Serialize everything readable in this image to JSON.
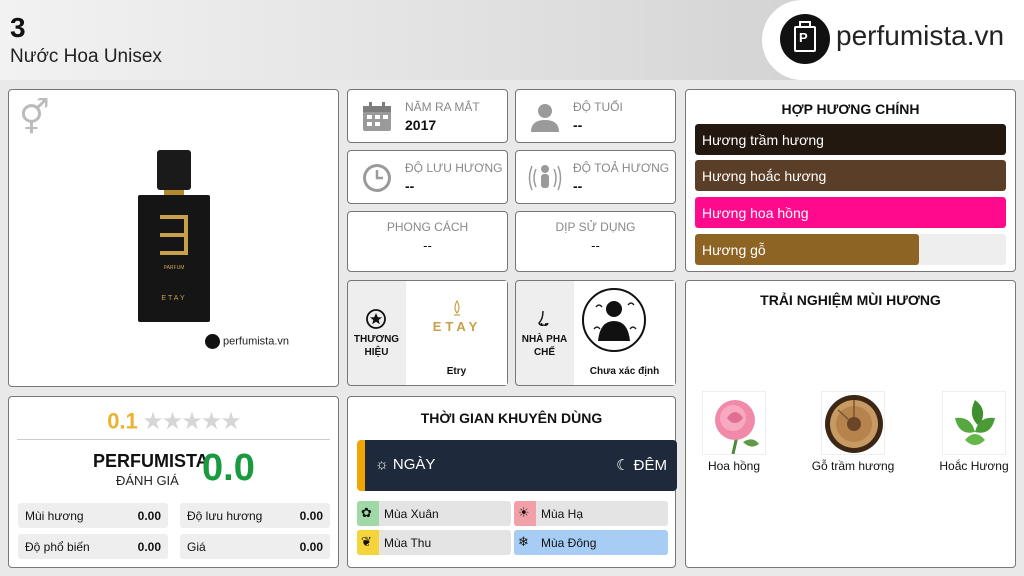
{
  "header": {
    "rank": "3",
    "subtitle": "Nước Hoa Unisex",
    "brand_site": "perfumista.vn"
  },
  "product": {
    "gender_icon": "male-female-icon",
    "bottle_brand": "ETAY",
    "bottle_label": "PARFUM",
    "watermark": "perfumista.vn"
  },
  "rating": {
    "user_score": "0.1",
    "stars": "★★★★★",
    "site_label": "PERFUMISTA",
    "site_sub": "ĐÁNH GIÁ",
    "site_score": "0.0",
    "metrics": [
      {
        "label": "Mùi hương",
        "value": "0.00"
      },
      {
        "label": "Độ lưu hương",
        "value": "0.00"
      },
      {
        "label": "Độ phổ biến",
        "value": "0.00"
      },
      {
        "label": "Giá",
        "value": "0.00"
      }
    ]
  },
  "info": {
    "release": {
      "label": "NĂM RA MẮT",
      "value": "2017"
    },
    "age": {
      "label": "ĐỘ TUỔI",
      "value": "--"
    },
    "longevity": {
      "label": "ĐỘ LƯU HƯƠNG",
      "value": "--"
    },
    "sillage": {
      "label": "ĐỘ TOẢ HƯƠNG",
      "value": "--"
    },
    "style": {
      "label": "PHONG CÁCH",
      "value": "--"
    },
    "occasion": {
      "label": "DỊP SỬ DỤNG",
      "value": "--"
    },
    "brand": {
      "label": "THƯƠNG HIỆU",
      "logo_text": "ETAY",
      "name": "Etry"
    },
    "perfumer": {
      "label": "NHÀ PHA CHẾ",
      "name": "Chưa xác định"
    }
  },
  "time": {
    "title": "THỜI GIAN KHUYÊN DÙNG",
    "day": "NGÀY",
    "night": "ĐÊM",
    "seasons": [
      {
        "label": "Mùa Xuân",
        "color": "#9ed9a6"
      },
      {
        "label": "Mùa Hạ",
        "color": "#f2a0a8"
      },
      {
        "label": "Mùa Thu",
        "color": "#f5d33a"
      },
      {
        "label": "Mùa Đông",
        "color": "#a7cdf5"
      }
    ]
  },
  "accords": {
    "title": "HỢP HƯƠNG CHÍNH",
    "items": [
      {
        "label": "Hương trầm hương",
        "color": "#23180f",
        "percent": 100
      },
      {
        "label": "Hương hoắc hương",
        "color": "#5b3e27",
        "percent": 100
      },
      {
        "label": "Hương hoa hồng",
        "color": "#ff0a8c",
        "percent": 100
      },
      {
        "label": "Hương gỗ",
        "color": "#8e6424",
        "percent": 72
      }
    ]
  },
  "experience": {
    "title": "TRẢI NGHIỆM MÙI HƯƠNG",
    "notes": [
      {
        "label": "Hoa hồng",
        "icon": "rose-icon"
      },
      {
        "label": "Gỗ trầm hương",
        "icon": "agarwood-icon"
      },
      {
        "label": "Hoắc Hương",
        "icon": "patchouli-icon"
      }
    ]
  }
}
